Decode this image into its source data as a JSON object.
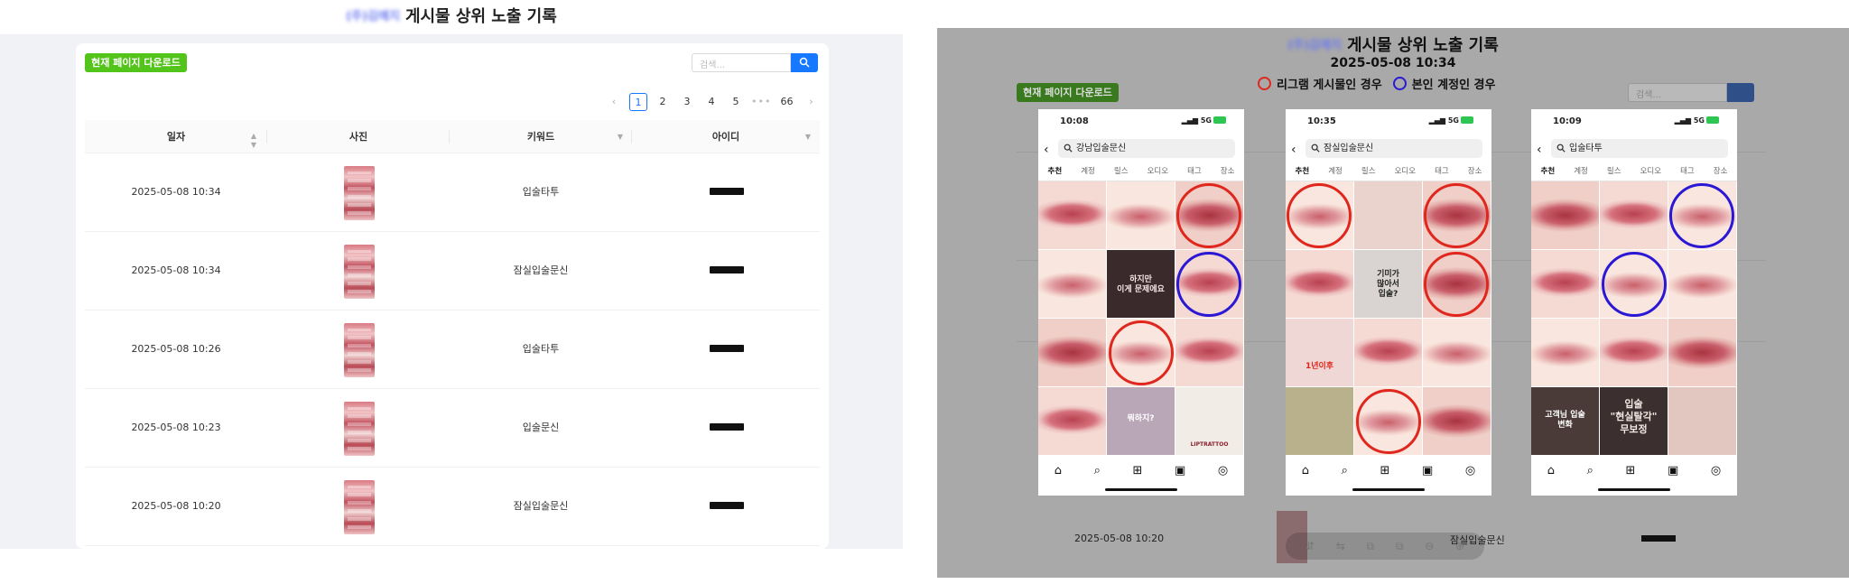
{
  "brand_blurred": "(주)김예지",
  "page_title": "게시물 상위 노출 기록",
  "toolbar": {
    "download_label": "현재 페이지 다운로드",
    "search_placeholder": "검색..."
  },
  "pagination": {
    "prev": "‹",
    "pages": [
      "1",
      "2",
      "3",
      "4",
      "5"
    ],
    "active_page": "1",
    "ellipsis": "•••",
    "last_page": "66",
    "next": "›"
  },
  "table": {
    "columns": [
      "일자",
      "사진",
      "키워드",
      "아이디"
    ],
    "rows": [
      {
        "date": "2025-05-08 10:34",
        "keyword": "입술타투"
      },
      {
        "date": "2025-05-08 10:34",
        "keyword": "잠실입술문신"
      },
      {
        "date": "2025-05-08 10:26",
        "keyword": "입술타투"
      },
      {
        "date": "2025-05-08 10:23",
        "keyword": "입술문신"
      },
      {
        "date": "2025-05-08 10:20",
        "keyword": "잠실입술문신"
      }
    ]
  },
  "overlay": {
    "title": "게시물 상위 노출 기록",
    "date": "2025-05-08 10:34",
    "legend": [
      {
        "label": "리그램 게시물인 경우",
        "color": "#e0271d"
      },
      {
        "label": "본인 계정인 경우",
        "color": "#2a18d4"
      }
    ],
    "phones": [
      {
        "time": "10:08",
        "query": "강남입술문신"
      },
      {
        "time": "10:35",
        "query": "잠실입술문신"
      },
      {
        "time": "10:09",
        "query": "입술타투"
      }
    ],
    "signal": "5G",
    "tabs": [
      "추천",
      "계정",
      "릴스",
      "오디오",
      "태그",
      "장소"
    ],
    "tile_texts": {
      "p1_t5": "하지만 \n이게 문제에요",
      "p1_t11": "뭐하지?",
      "p1_t12": "LIPTRATTOO",
      "p2_t5": "기미가 \n많아서 \n입술?",
      "p2_t7": "1년이후",
      "p3_t10": "고객님 입술 \n 변화",
      "p3_t11": "입술\n\"현실탈각\"\n무보정"
    },
    "ghost_row": {
      "date": "2025-05-08 10:20",
      "keyword": "잠실입술문신"
    },
    "viewer_tools": [
      "⇵",
      "⇆",
      "⧉",
      "⧉",
      "⊖",
      "⊕"
    ],
    "nav_icons": [
      "⌂",
      "⌕",
      "⊞",
      "▣",
      "◎"
    ]
  }
}
